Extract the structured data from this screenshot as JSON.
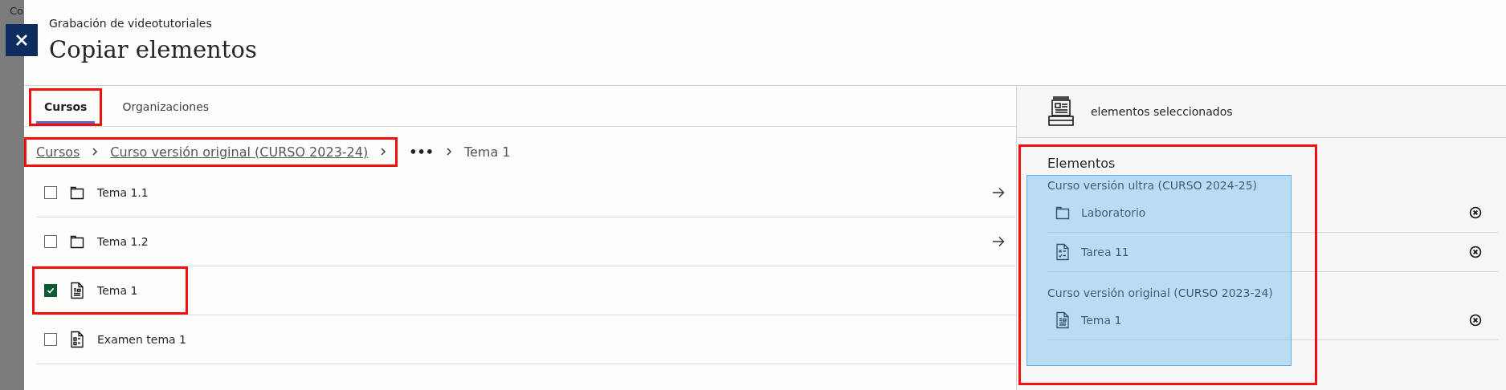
{
  "background_text": "Co",
  "header": {
    "subtitle": "Grabación de videotutoriales",
    "title": "Copiar elementos"
  },
  "tabs": [
    {
      "label": "Cursos",
      "selected": true,
      "marked": true
    },
    {
      "label": "Organizaciones",
      "selected": false,
      "marked": false
    }
  ],
  "breadcrumb": {
    "marked": [
      {
        "label": "Cursos"
      },
      {
        "label": "Curso versión original (CURSO 2023-24)"
      }
    ],
    "rest": [
      {
        "label": "•••"
      },
      {
        "label": "Tema 1"
      }
    ]
  },
  "rows": [
    {
      "label": "Tema 1.1",
      "kind": "folder",
      "checked": false,
      "has_arrow": true,
      "marked": false
    },
    {
      "label": "Tema 1.2",
      "kind": "folder",
      "checked": false,
      "has_arrow": true,
      "marked": false
    },
    {
      "label": "Tema 1",
      "kind": "document",
      "checked": true,
      "has_arrow": false,
      "marked": true
    },
    {
      "label": "Examen tema 1",
      "kind": "test",
      "checked": false,
      "has_arrow": false,
      "marked": false
    }
  ],
  "selection_panel": {
    "header": "elementos seleccionados",
    "heading": "Elementos",
    "groups": [
      {
        "course": "Curso versión ultra (CURSO 2024-25)",
        "items": [
          {
            "label": "Laboratorio",
            "kind": "folder"
          },
          {
            "label": "Tarea 11",
            "kind": "assignment"
          }
        ]
      },
      {
        "course": "Curso versión original (CURSO 2023-24)",
        "items": [
          {
            "label": "Tema 1",
            "kind": "document"
          }
        ]
      }
    ]
  }
}
